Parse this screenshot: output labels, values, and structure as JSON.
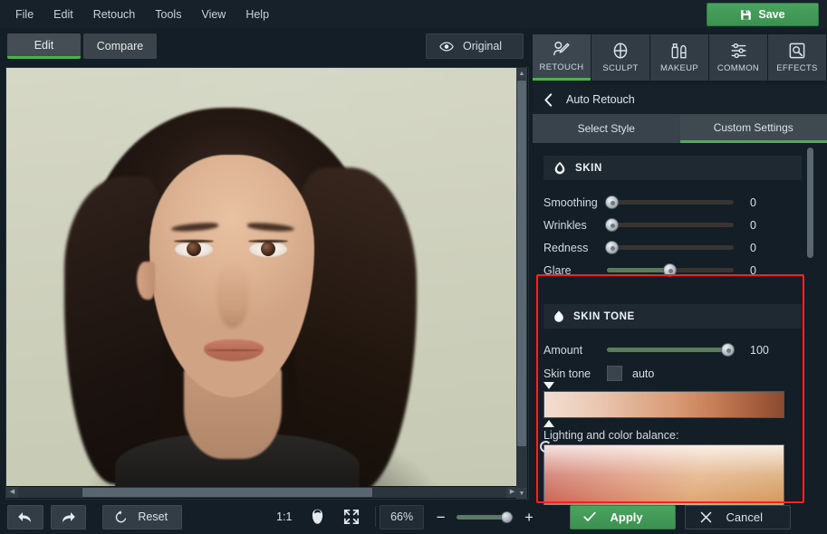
{
  "app": {
    "menu": [
      "File",
      "Edit",
      "Retouch",
      "Tools",
      "View",
      "Help"
    ],
    "save_label": "Save"
  },
  "subtoolbar": {
    "edit_label": "Edit",
    "compare_label": "Compare",
    "original_label": "Original"
  },
  "canvas": {
    "zoom_level": "66%",
    "ratio_label": "1:1"
  },
  "bottom_toolbar": {
    "undo_name": "undo",
    "redo_name": "redo",
    "reset_label": "Reset",
    "fit_name": "fit-to-screen",
    "face_name": "fit-to-face"
  },
  "right_panel": {
    "mode_tabs": [
      {
        "label": "RETOUCH",
        "icon": "retouch-icon",
        "active": true
      },
      {
        "label": "SCULPT",
        "icon": "sculpt-icon",
        "active": false
      },
      {
        "label": "MAKEUP",
        "icon": "makeup-icon",
        "active": false
      },
      {
        "label": "COMMON",
        "icon": "common-icon",
        "active": false
      },
      {
        "label": "EFFECTS",
        "icon": "effects-icon",
        "active": false
      }
    ],
    "panel_title": "Auto Retouch",
    "segments": [
      {
        "label": "Select Style",
        "active": false
      },
      {
        "label": "Custom Settings",
        "active": true
      }
    ],
    "skin_group": {
      "title": "SKIN",
      "sliders": [
        {
          "label": "Smoothing",
          "value": "0",
          "percent": 0
        },
        {
          "label": "Wrinkles",
          "value": "0",
          "percent": 0
        },
        {
          "label": "Redness",
          "value": "0",
          "percent": 0
        },
        {
          "label": "Glare",
          "value": "0",
          "percent": 50
        }
      ]
    },
    "skin_tone_group": {
      "title": "SKIN TONE",
      "amount_label": "Amount",
      "amount_value": "100",
      "amount_percent": 100,
      "skin_tone_label": "Skin tone",
      "auto_label": "auto",
      "balance_label": "Lighting and color balance:"
    },
    "apply_label": "Apply",
    "cancel_label": "Cancel"
  },
  "colors": {
    "accent_green": "#4caf50",
    "save_green": "#3d9152",
    "highlight_red": "#ff1d1d",
    "panel_bg": "#131e26"
  }
}
